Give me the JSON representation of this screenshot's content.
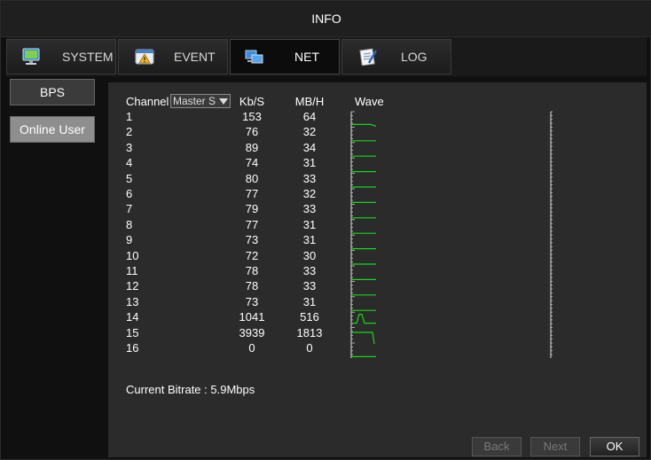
{
  "window": {
    "title": "INFO"
  },
  "tabs": [
    {
      "label": "SYSTEM",
      "icon": "monitor-icon"
    },
    {
      "label": "EVENT",
      "icon": "warning-icon"
    },
    {
      "label": "NET",
      "icon": "network-icon",
      "active": true
    },
    {
      "label": "LOG",
      "icon": "log-icon"
    }
  ],
  "sidebar": {
    "items": [
      {
        "label": "BPS",
        "active": true
      },
      {
        "label": "Online User"
      }
    ]
  },
  "table": {
    "headers": {
      "channel": "Channel",
      "stream": "Master S",
      "kbs": "Kb/S",
      "mbh": "MB/H",
      "wave": "Wave"
    },
    "rows": [
      {
        "ch": "1",
        "kbs": "153",
        "mbh": "64"
      },
      {
        "ch": "2",
        "kbs": "76",
        "mbh": "32"
      },
      {
        "ch": "3",
        "kbs": "89",
        "mbh": "34"
      },
      {
        "ch": "4",
        "kbs": "74",
        "mbh": "31"
      },
      {
        "ch": "5",
        "kbs": "80",
        "mbh": "33"
      },
      {
        "ch": "6",
        "kbs": "77",
        "mbh": "32"
      },
      {
        "ch": "7",
        "kbs": "79",
        "mbh": "33"
      },
      {
        "ch": "8",
        "kbs": "77",
        "mbh": "31"
      },
      {
        "ch": "9",
        "kbs": "73",
        "mbh": "31"
      },
      {
        "ch": "10",
        "kbs": "72",
        "mbh": "30"
      },
      {
        "ch": "11",
        "kbs": "78",
        "mbh": "33"
      },
      {
        "ch": "12",
        "kbs": "78",
        "mbh": "33"
      },
      {
        "ch": "13",
        "kbs": "73",
        "mbh": "31"
      },
      {
        "ch": "14",
        "kbs": "1041",
        "mbh": "516"
      },
      {
        "ch": "15",
        "kbs": "3939",
        "mbh": "1813"
      },
      {
        "ch": "16",
        "kbs": "0",
        "mbh": "0"
      }
    ]
  },
  "status": {
    "current_bitrate": "Current Bitrate : 5.9Mbps"
  },
  "buttons": {
    "back": "Back",
    "next": "Next",
    "ok": "OK"
  },
  "colors": {
    "wave": "#19d619",
    "panel": "#2b2b2b"
  }
}
